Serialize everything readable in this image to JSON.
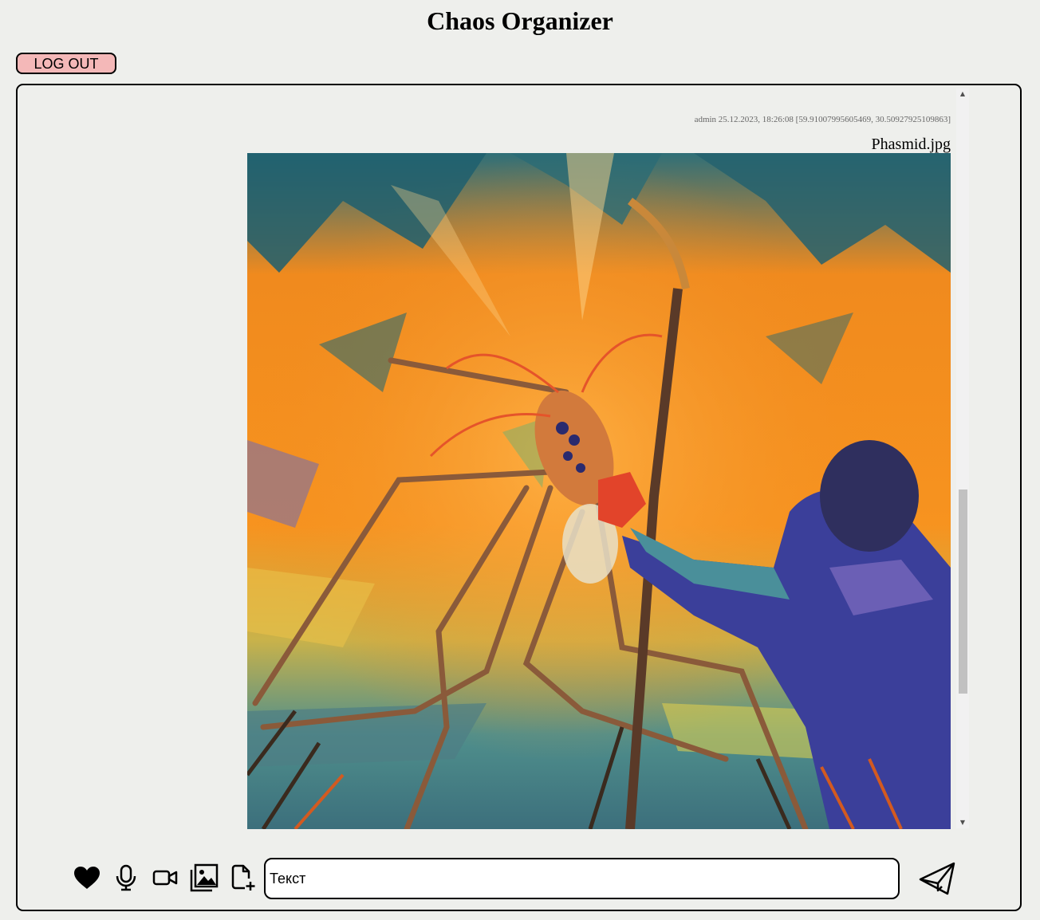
{
  "app": {
    "title": "Chaos Organizer",
    "logout_label": "LOG OUT"
  },
  "feed": {
    "messages": [
      {
        "meta": "admin 25.12.2023, 18:26:08 [59.91007995605469, 30.50927925109863]",
        "filename": "Phasmid.jpg",
        "attachment_type": "image"
      }
    ],
    "scroll": {
      "position": 0.76
    }
  },
  "composer": {
    "tools": [
      {
        "name": "like",
        "icon": "heart-icon"
      },
      {
        "name": "audio",
        "icon": "microphone-icon"
      },
      {
        "name": "video",
        "icon": "video-camera-icon"
      },
      {
        "name": "image",
        "icon": "image-gallery-icon"
      },
      {
        "name": "file",
        "icon": "add-file-icon"
      }
    ],
    "input_placeholder": "Текст",
    "send_icon": "paper-plane-icon"
  },
  "colors": {
    "background": "#eeefec",
    "logout_button": "#f4b8b8",
    "border": "#000000"
  }
}
